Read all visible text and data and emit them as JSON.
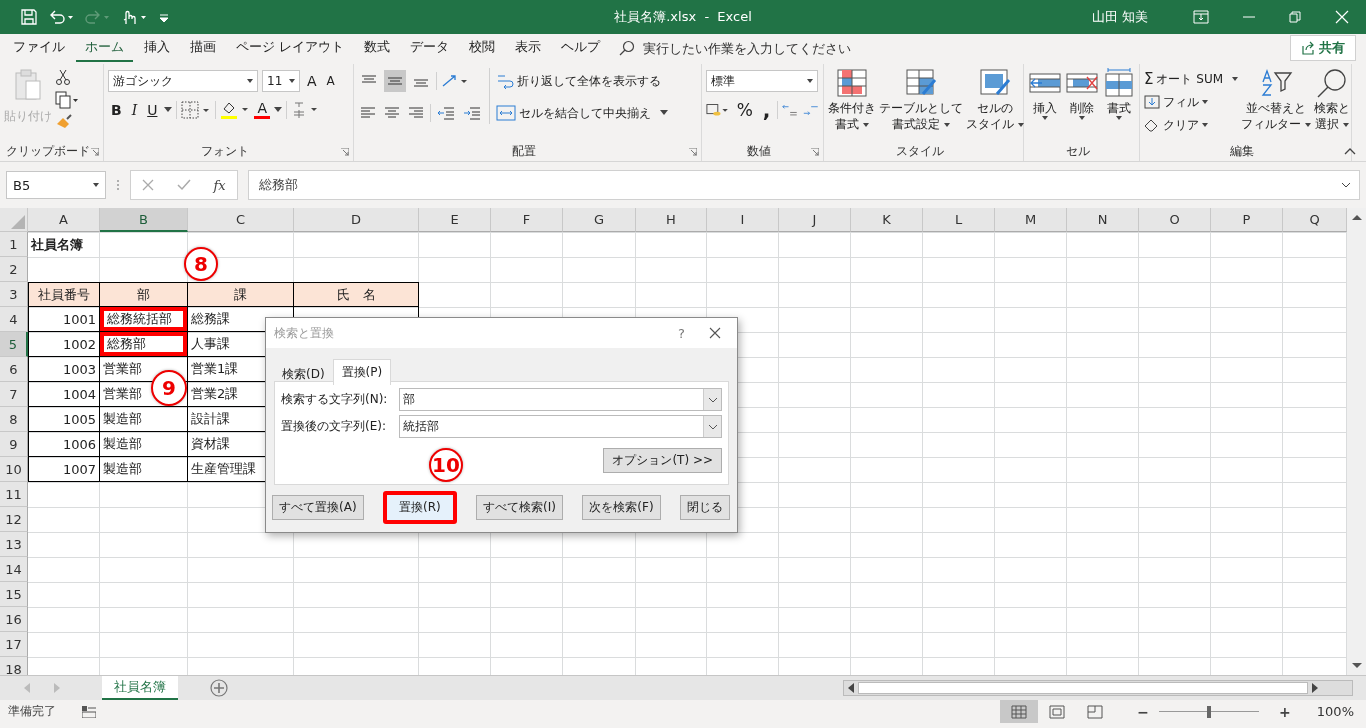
{
  "title_bar": {
    "file_title": "社員名簿.xlsx  -  Excel",
    "user": "山田 知美"
  },
  "menu_tabs": [
    {
      "label": "ファイル",
      "selected": false
    },
    {
      "label": "ホーム",
      "selected": true
    },
    {
      "label": "挿入",
      "selected": false
    },
    {
      "label": "描画",
      "selected": false
    },
    {
      "label": "ページ レイアウト",
      "selected": false
    },
    {
      "label": "数式",
      "selected": false
    },
    {
      "label": "データ",
      "selected": false
    },
    {
      "label": "校閲",
      "selected": false
    },
    {
      "label": "表示",
      "selected": false
    },
    {
      "label": "ヘルプ",
      "selected": false
    }
  ],
  "tell_me": {
    "placeholder": "実行したい作業を入力してください"
  },
  "share_button": "共有",
  "ribbon": {
    "clipboard": {
      "label": "クリップボード",
      "paste": {
        "label": "貼り付け",
        "disabled": true
      }
    },
    "font": {
      "label": "フォント",
      "font_name": "游ゴシック",
      "font_size": "11",
      "grow": "A",
      "shrink": "A",
      "bold": "B",
      "italic": "I",
      "underline": "U",
      "font_color": "A"
    },
    "alignment": {
      "label": "配置",
      "vertical": [
        {
          "selected": false
        },
        {
          "selected": true
        },
        {
          "selected": false
        }
      ],
      "wrap_text": "折り返して全体を表示する",
      "merge_center": "セルを結合して中央揃え"
    },
    "number": {
      "label": "数値",
      "format": "標準",
      "percent": "%",
      "comma": ","
    },
    "styles": {
      "label": "スタイル",
      "buttons": [
        {
          "lines": [
            "条件付き",
            "書式"
          ],
          "kind": "conditional"
        },
        {
          "lines": [
            "テーブルとして",
            "書式設定"
          ],
          "kind": "table"
        },
        {
          "lines": [
            "セルの",
            "スタイル"
          ],
          "kind": "cellstyle"
        }
      ]
    },
    "cells": {
      "label": "セル",
      "buttons": [
        {
          "label": "挿入",
          "kind": "insert"
        },
        {
          "label": "削除",
          "kind": "delete"
        },
        {
          "label": "書式",
          "kind": "format"
        }
      ]
    },
    "editing": {
      "label": "編集",
      "sigma": "Σ",
      "autosum": "オート SUM",
      "fill": "フィル",
      "clear": "クリア",
      "sort_filter": [
        "並べ替えと",
        "フィルター"
      ],
      "find_select": [
        "検索と",
        "選択"
      ]
    }
  },
  "formula_bar": {
    "name_box": "B5",
    "function_label": "fx",
    "formula": "総務部"
  },
  "sheet": {
    "columns": [
      {
        "label": "A",
        "selected": false
      },
      {
        "label": "B",
        "selected": true
      },
      {
        "label": "C",
        "selected": false
      },
      {
        "label": "D",
        "selected": false
      },
      {
        "label": "E",
        "selected": false
      },
      {
        "label": "F",
        "selected": false
      },
      {
        "label": "G",
        "selected": false
      },
      {
        "label": "H",
        "selected": false
      },
      {
        "label": "I",
        "selected": false
      },
      {
        "label": "J",
        "selected": false
      },
      {
        "label": "K",
        "selected": false
      },
      {
        "label": "L",
        "selected": false
      },
      {
        "label": "M",
        "selected": false
      },
      {
        "label": "N",
        "selected": false
      },
      {
        "label": "O",
        "selected": false
      },
      {
        "label": "P",
        "selected": false
      },
      {
        "label": "Q",
        "selected": false
      }
    ],
    "rows": [
      {
        "header": "1",
        "selected": false,
        "kind": "title",
        "cells": [
          {
            "text": "社員名簿",
            "highlighted": false,
            "active": false
          }
        ]
      },
      {
        "header": "2",
        "selected": false,
        "kind": "blank"
      },
      {
        "header": "3",
        "selected": false,
        "kind": "header",
        "cells": [
          {
            "text": "社員番号",
            "highlighted": false,
            "active": false
          },
          {
            "text": "部",
            "highlighted": false,
            "active": false
          },
          {
            "text": "課",
            "highlighted": false,
            "active": false
          },
          {
            "text": "氏　名",
            "highlighted": false,
            "active": false
          }
        ]
      },
      {
        "header": "4",
        "selected": false,
        "kind": "data",
        "cells": [
          {
            "text": "1001",
            "highlighted": false,
            "active": false
          },
          {
            "text": "総務統括部",
            "highlighted": true,
            "active": false
          },
          {
            "text": "総務課",
            "highlighted": false,
            "active": false
          }
        ]
      },
      {
        "header": "5",
        "selected": true,
        "kind": "data",
        "cells": [
          {
            "text": "1002",
            "highlighted": false,
            "active": false
          },
          {
            "text": "総務部",
            "highlighted": true,
            "active": true
          },
          {
            "text": "人事課",
            "highlighted": false,
            "active": false
          }
        ]
      },
      {
        "header": "6",
        "selected": false,
        "kind": "data",
        "cells": [
          {
            "text": "1003",
            "highlighted": false,
            "active": false
          },
          {
            "text": "営業部",
            "highlighted": false,
            "active": false
          },
          {
            "text": "営業1課",
            "highlighted": false,
            "active": false
          }
        ]
      },
      {
        "header": "7",
        "selected": false,
        "kind": "data",
        "cells": [
          {
            "text": "1004",
            "highlighted": false,
            "active": false
          },
          {
            "text": "営業部",
            "highlighted": false,
            "active": false
          },
          {
            "text": "営業2課",
            "highlighted": false,
            "active": false
          }
        ]
      },
      {
        "header": "8",
        "selected": false,
        "kind": "data",
        "cells": [
          {
            "text": "1005",
            "highlighted": false,
            "active": false
          },
          {
            "text": "製造部",
            "highlighted": false,
            "active": false
          },
          {
            "text": "設計課",
            "highlighted": false,
            "active": false
          }
        ]
      },
      {
        "header": "9",
        "selected": false,
        "kind": "data",
        "cells": [
          {
            "text": "1006",
            "highlighted": false,
            "active": false
          },
          {
            "text": "製造部",
            "highlighted": false,
            "active": false
          },
          {
            "text": "資材課",
            "highlighted": false,
            "active": false
          }
        ]
      },
      {
        "header": "10",
        "selected": false,
        "kind": "data",
        "cells": [
          {
            "text": "1007",
            "highlighted": false,
            "active": false
          },
          {
            "text": "製造部",
            "highlighted": false,
            "active": false
          },
          {
            "text": "生産管理課",
            "highlighted": false,
            "active": false
          }
        ]
      },
      {
        "header": "11",
        "selected": false,
        "kind": "blank"
      },
      {
        "header": "12",
        "selected": false,
        "kind": "blank"
      },
      {
        "header": "13",
        "selected": false,
        "kind": "blank"
      },
      {
        "header": "14",
        "selected": false,
        "kind": "blank"
      },
      {
        "header": "15",
        "selected": false,
        "kind": "blank"
      },
      {
        "header": "16",
        "selected": false,
        "kind": "blank"
      },
      {
        "header": "17",
        "selected": false,
        "kind": "blank"
      },
      {
        "header": "18",
        "selected": false,
        "kind": "blank"
      }
    ]
  },
  "annotations": [
    {
      "label": "8"
    },
    {
      "label": "9"
    },
    {
      "label": "10"
    }
  ],
  "dialog": {
    "title": "検索と置換",
    "help": "?",
    "tabs": [
      {
        "label": "検索(D)",
        "selected": false
      },
      {
        "label": "置換(P)",
        "selected": true
      }
    ],
    "fields": [
      {
        "label": "検索する文字列(N):",
        "value": "部"
      },
      {
        "label": "置換後の文字列(E):",
        "value": "統括部"
      }
    ],
    "options_button": "オプション(T) >>",
    "buttons": [
      {
        "label": "すべて置換(A)",
        "highlighted": false
      },
      {
        "label": "置換(R)",
        "highlighted": true
      },
      {
        "label": "すべて検索(I)",
        "highlighted": false
      },
      {
        "label": "次を検索(F)",
        "highlighted": false
      },
      {
        "label": "閉じる",
        "highlighted": false
      }
    ]
  },
  "sheet_tabs": [
    {
      "label": "社員名簿",
      "selected": true
    }
  ],
  "status_bar": {
    "text": "準備完了",
    "zoom_minus": "−",
    "zoom_plus": "+",
    "zoom_slider": {
      "level": 0.5
    },
    "zoom": "100%"
  }
}
